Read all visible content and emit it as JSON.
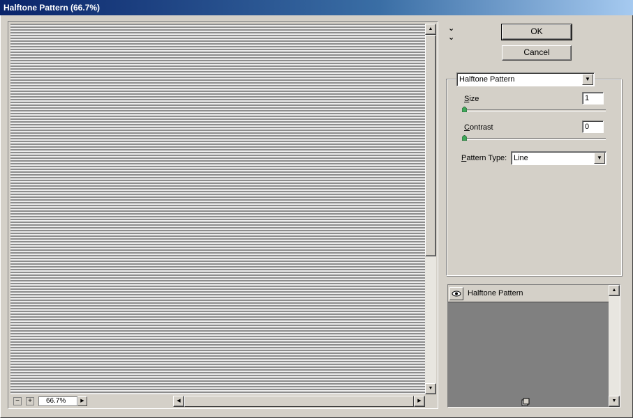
{
  "window": {
    "title": "Halftone Pattern (66.7%)"
  },
  "preview": {
    "zoom": "66.7%",
    "zoom_out_icon": "minus-icon",
    "zoom_in_icon": "plus-icon"
  },
  "buttons": {
    "ok_label": "OK",
    "cancel_label": "Cancel"
  },
  "filter": {
    "selected": "Halftone Pattern",
    "size": {
      "label_first": "S",
      "label_rest": "ize",
      "value": "1",
      "slider_fraction": 0.0
    },
    "contrast": {
      "label_first": "C",
      "label_rest": "ontrast",
      "value": "0",
      "slider_fraction": 0.0
    },
    "pattern_type": {
      "label_first": "P",
      "label_rest": "attern Type:",
      "value": "Line"
    }
  },
  "layers": {
    "items": [
      {
        "name": "Halftone Pattern",
        "visible": true
      }
    ]
  },
  "colors": {
    "titlebar_start": "#0a246a",
    "titlebar_end": "#a6caf0",
    "face": "#d4d0c8",
    "layers_bg": "#808080"
  }
}
